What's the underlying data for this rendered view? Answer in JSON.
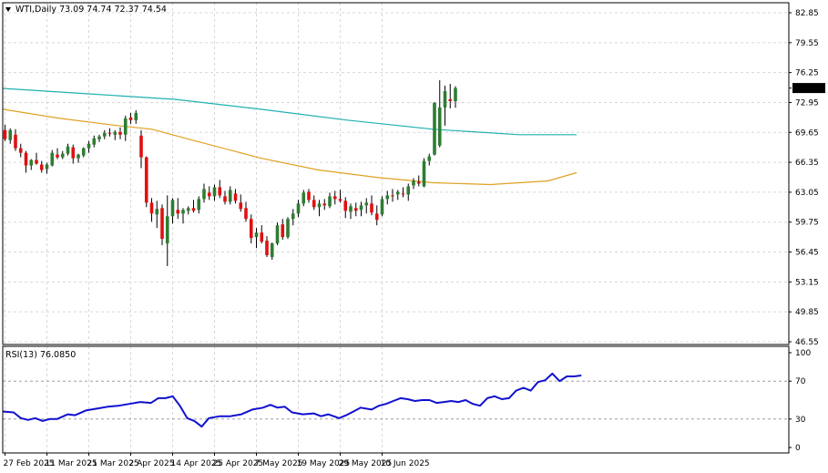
{
  "header": {
    "symbol_line": "WTI,Daily  73.09 74.74 72.37 74.54",
    "rsi_label": "RSI(13) 76.0850"
  },
  "price_badge": "74.54",
  "colors": {
    "bull": "#2e7d32",
    "bear": "#e01010",
    "ma_slow": "#20b0b0",
    "ma_fast": "#e0a020",
    "rsi": "#1010d0",
    "grid": "#d8d8d8",
    "badge_bg": "#000000",
    "badge_fg": "#ffffff"
  },
  "chart_data": [
    {
      "type": "candlestick",
      "title": "WTI,Daily",
      "ylim": [
        46.55,
        82.85
      ],
      "y_ticks": [
        "82.85",
        "79.55",
        "76.25",
        "72.95",
        "69.65",
        "66.35",
        "63.05",
        "59.75",
        "56.45",
        "53.15",
        "49.85",
        "46.55"
      ],
      "x_ticks": [
        "27 Feb 2025",
        "11 Mar 2025",
        "21 Mar 2025",
        "2 Apr 2025",
        "14 Apr 2025",
        "25 Apr 2025",
        "7 May 2025",
        "19 May 2025",
        "29 May 2025",
        "10 Jun 2025"
      ],
      "x_tick_index": [
        0,
        8,
        16,
        24,
        32,
        40,
        48,
        56,
        64,
        72
      ],
      "candles": [
        [
          69.9,
          70.5,
          68.7,
          68.9
        ],
        [
          68.8,
          70.1,
          68.4,
          69.9
        ],
        [
          69.4,
          70.0,
          67.6,
          67.9
        ],
        [
          67.9,
          68.4,
          66.9,
          67.4
        ],
        [
          67.4,
          67.6,
          65.2,
          66.0
        ],
        [
          66.0,
          66.7,
          65.5,
          66.6
        ],
        [
          66.6,
          67.4,
          66.1,
          66.2
        ],
        [
          66.1,
          66.5,
          65.2,
          65.5
        ],
        [
          65.6,
          66.3,
          65.1,
          66.1
        ],
        [
          66.0,
          67.7,
          65.9,
          67.4
        ],
        [
          67.2,
          67.9,
          66.7,
          66.9
        ],
        [
          66.9,
          67.6,
          66.7,
          67.3
        ],
        [
          67.3,
          68.4,
          67.1,
          68.1
        ],
        [
          68.0,
          68.3,
          66.2,
          66.8
        ],
        [
          66.8,
          67.3,
          66.3,
          67.2
        ],
        [
          67.1,
          68.0,
          66.9,
          67.9
        ],
        [
          67.9,
          68.7,
          67.4,
          68.4
        ],
        [
          68.3,
          69.3,
          68.0,
          69.0
        ],
        [
          68.9,
          69.4,
          68.6,
          69.2
        ],
        [
          69.2,
          69.9,
          68.9,
          69.6
        ],
        [
          69.6,
          70.1,
          69.2,
          69.5
        ],
        [
          69.4,
          69.9,
          68.8,
          69.7
        ],
        [
          69.7,
          70.2,
          68.9,
          69.4
        ],
        [
          69.4,
          71.5,
          68.7,
          71.2
        ],
        [
          71.3,
          71.8,
          70.6,
          71.0
        ],
        [
          71.0,
          72.1,
          70.6,
          71.8
        ],
        [
          69.3,
          69.9,
          65.7,
          66.9
        ],
        [
          66.9,
          67.0,
          61.4,
          61.9
        ],
        [
          61.9,
          62.4,
          59.8,
          60.7
        ],
        [
          60.6,
          62.1,
          59.1,
          61.2
        ],
        [
          61.3,
          61.7,
          57.2,
          57.9
        ],
        [
          57.4,
          62.7,
          54.9,
          60.4
        ],
        [
          60.4,
          62.4,
          59.6,
          62.2
        ],
        [
          61.1,
          62.4,
          60.1,
          60.7
        ],
        [
          60.7,
          61.3,
          59.6,
          61.1
        ],
        [
          61.0,
          61.5,
          60.6,
          61.3
        ],
        [
          61.3,
          62.2,
          60.8,
          61.0
        ],
        [
          61.1,
          62.6,
          60.7,
          62.3
        ],
        [
          62.3,
          64.0,
          61.9,
          63.4
        ],
        [
          63.0,
          63.7,
          62.2,
          62.6
        ],
        [
          62.6,
          63.9,
          62.1,
          63.6
        ],
        [
          63.6,
          64.4,
          62.4,
          62.7
        ],
        [
          62.6,
          63.2,
          61.7,
          62.0
        ],
        [
          62.0,
          63.7,
          61.7,
          63.3
        ],
        [
          62.9,
          63.4,
          61.8,
          62.1
        ],
        [
          61.9,
          62.8,
          60.9,
          61.2
        ],
        [
          61.3,
          62.0,
          59.8,
          60.1
        ],
        [
          60.1,
          60.6,
          57.4,
          58.0
        ],
        [
          58.1,
          59.1,
          56.9,
          58.6
        ],
        [
          58.6,
          59.4,
          57.4,
          57.6
        ],
        [
          57.7,
          58.2,
          55.9,
          56.1
        ],
        [
          55.9,
          57.5,
          55.6,
          57.4
        ],
        [
          57.4,
          59.7,
          57.2,
          59.4
        ],
        [
          59.5,
          60.1,
          57.8,
          58.1
        ],
        [
          58.1,
          60.3,
          57.9,
          60.1
        ],
        [
          60.1,
          61.2,
          59.4,
          60.7
        ],
        [
          60.7,
          62.2,
          60.3,
          61.8
        ],
        [
          61.8,
          63.3,
          61.5,
          63.0
        ],
        [
          63.1,
          63.4,
          61.9,
          62.2
        ],
        [
          62.2,
          62.7,
          61.1,
          61.4
        ],
        [
          61.4,
          62.2,
          60.4,
          61.8
        ],
        [
          61.8,
          62.3,
          61.1,
          61.6
        ],
        [
          61.5,
          63.0,
          61.3,
          62.6
        ],
        [
          62.6,
          63.2,
          61.7,
          62.3
        ],
        [
          62.3,
          63.3,
          61.9,
          62.1
        ],
        [
          62.1,
          62.5,
          60.2,
          61.0
        ],
        [
          60.9,
          61.8,
          60.1,
          61.5
        ],
        [
          61.3,
          61.9,
          60.4,
          61.0
        ],
        [
          61.1,
          62.0,
          60.4,
          61.6
        ],
        [
          61.6,
          62.4,
          60.7,
          61.9
        ],
        [
          61.8,
          62.7,
          60.5,
          60.8
        ],
        [
          60.7,
          61.6,
          59.4,
          60.0
        ],
        [
          60.6,
          62.6,
          60.4,
          62.3
        ],
        [
          62.3,
          63.2,
          61.7,
          62.7
        ],
        [
          62.7,
          63.4,
          62.0,
          62.6
        ],
        [
          62.8,
          63.3,
          62.2,
          63.1
        ],
        [
          62.9,
          63.6,
          62.5,
          62.8
        ],
        [
          62.8,
          64.0,
          62.1,
          63.7
        ],
        [
          63.8,
          64.6,
          63.4,
          64.3
        ],
        [
          64.2,
          64.9,
          63.7,
          64.0
        ],
        [
          63.7,
          66.8,
          63.6,
          66.5
        ],
        [
          66.5,
          67.3,
          66.0,
          67.0
        ],
        [
          67.2,
          73.0,
          67.1,
          72.9
        ],
        [
          68.2,
          75.4,
          68.0,
          72.4
        ],
        [
          72.4,
          74.8,
          70.4,
          74.2
        ],
        [
          73.3,
          75.0,
          72.3,
          73.1
        ],
        [
          73.09,
          74.74,
          72.37,
          74.54
        ]
      ],
      "ma_slow": [
        {
          "i": 0,
          "v": 74.5
        },
        {
          "i": 15,
          "v": 73.9
        },
        {
          "i": 30,
          "v": 73.3
        },
        {
          "i": 45,
          "v": 72.2
        },
        {
          "i": 60,
          "v": 71.0
        },
        {
          "i": 75,
          "v": 70.0
        },
        {
          "i": 90,
          "v": 69.4
        },
        {
          "i": 100,
          "v": 69.4
        }
      ],
      "ma_fast": [
        {
          "i": 0,
          "v": 72.2
        },
        {
          "i": 10,
          "v": 71.2
        },
        {
          "i": 20,
          "v": 70.4
        },
        {
          "i": 26,
          "v": 70.0
        },
        {
          "i": 33,
          "v": 68.8
        },
        {
          "i": 45,
          "v": 66.8
        },
        {
          "i": 55,
          "v": 65.5
        },
        {
          "i": 65,
          "v": 64.7
        },
        {
          "i": 75,
          "v": 64.1
        },
        {
          "i": 85,
          "v": 63.9
        },
        {
          "i": 95,
          "v": 64.3
        },
        {
          "i": 100,
          "v": 65.2
        }
      ]
    },
    {
      "type": "line",
      "title": "RSI(13) 76.0850",
      "ylim": [
        0,
        100
      ],
      "y_ticks": [
        "100",
        "70",
        "30",
        "0"
      ],
      "levels": [
        70,
        30
      ],
      "points": [
        {
          "i": 0,
          "v": 38
        },
        {
          "i": 3,
          "v": 37
        },
        {
          "i": 5,
          "v": 31
        },
        {
          "i": 7,
          "v": 29
        },
        {
          "i": 9,
          "v": 31
        },
        {
          "i": 11,
          "v": 28
        },
        {
          "i": 13,
          "v": 30
        },
        {
          "i": 15,
          "v": 30
        },
        {
          "i": 18,
          "v": 35
        },
        {
          "i": 20,
          "v": 34
        },
        {
          "i": 23,
          "v": 39
        },
        {
          "i": 26,
          "v": 41
        },
        {
          "i": 29,
          "v": 43
        },
        {
          "i": 32,
          "v": 44
        },
        {
          "i": 35,
          "v": 46
        },
        {
          "i": 38,
          "v": 48
        },
        {
          "i": 41,
          "v": 47
        },
        {
          "i": 43,
          "v": 52
        },
        {
          "i": 45,
          "v": 52
        },
        {
          "i": 47,
          "v": 54
        },
        {
          "i": 49,
          "v": 44
        },
        {
          "i": 51,
          "v": 31
        },
        {
          "i": 53,
          "v": 28
        },
        {
          "i": 55,
          "v": 22
        },
        {
          "i": 57,
          "v": 31
        },
        {
          "i": 60,
          "v": 33
        },
        {
          "i": 63,
          "v": 33
        },
        {
          "i": 66,
          "v": 35
        },
        {
          "i": 69,
          "v": 40
        },
        {
          "i": 72,
          "v": 42
        },
        {
          "i": 74,
          "v": 45
        },
        {
          "i": 76,
          "v": 42
        },
        {
          "i": 78,
          "v": 43
        },
        {
          "i": 80,
          "v": 37
        },
        {
          "i": 83,
          "v": 35
        },
        {
          "i": 86,
          "v": 36
        },
        {
          "i": 88,
          "v": 33
        },
        {
          "i": 90,
          "v": 35
        },
        {
          "i": 93,
          "v": 31
        },
        {
          "i": 95,
          "v": 34
        },
        {
          "i": 97,
          "v": 38
        },
        {
          "i": 99,
          "v": 42
        },
        {
          "i": 102,
          "v": 40
        },
        {
          "i": 104,
          "v": 44
        },
        {
          "i": 106,
          "v": 46
        },
        {
          "i": 108,
          "v": 49
        },
        {
          "i": 110,
          "v": 52
        },
        {
          "i": 112,
          "v": 51
        },
        {
          "i": 114,
          "v": 49
        },
        {
          "i": 116,
          "v": 50
        },
        {
          "i": 118,
          "v": 50
        },
        {
          "i": 120,
          "v": 47
        },
        {
          "i": 122,
          "v": 48
        },
        {
          "i": 124,
          "v": 49
        },
        {
          "i": 126,
          "v": 48
        },
        {
          "i": 128,
          "v": 50
        },
        {
          "i": 130,
          "v": 46
        },
        {
          "i": 132,
          "v": 44
        },
        {
          "i": 134,
          "v": 52
        },
        {
          "i": 136,
          "v": 54
        },
        {
          "i": 138,
          "v": 51
        },
        {
          "i": 140,
          "v": 52
        },
        {
          "i": 142,
          "v": 60
        },
        {
          "i": 144,
          "v": 63
        },
        {
          "i": 146,
          "v": 60
        },
        {
          "i": 148,
          "v": 69
        },
        {
          "i": 150,
          "v": 71
        },
        {
          "i": 152,
          "v": 78
        },
        {
          "i": 154,
          "v": 70
        },
        {
          "i": 156,
          "v": 75
        },
        {
          "i": 158,
          "v": 75
        },
        {
          "i": 160,
          "v": 76
        }
      ]
    }
  ]
}
